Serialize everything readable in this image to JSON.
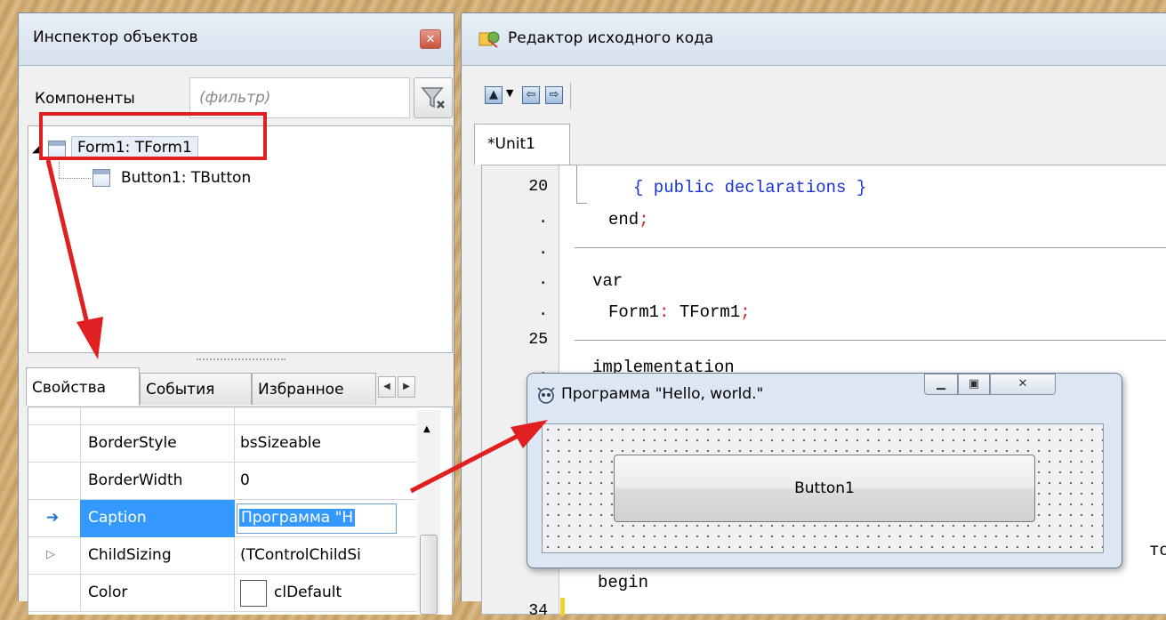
{
  "inspector": {
    "title": "Инспектор объектов",
    "close_icon": "close-icon",
    "filter_label": "Компоненты",
    "filter_placeholder": "(фильтр)",
    "tree": [
      {
        "label": "Form1: TForm1"
      },
      {
        "label": "Button1: TButton"
      }
    ],
    "tabs": [
      "Свойства",
      "События",
      "Избранное"
    ],
    "properties": [
      {
        "name": "BorderStyle",
        "value": "bsSizeable"
      },
      {
        "name": "BorderWidth",
        "value": "0"
      },
      {
        "name": "Caption",
        "value": "Программа \"Н"
      },
      {
        "name": "ChildSizing",
        "value": "(TControlChildSi"
      },
      {
        "name": "Color",
        "value": "clDefault"
      }
    ]
  },
  "editor": {
    "title": "Редактор исходного кода",
    "tab": "*Unit1",
    "line_numbers": [
      "20",
      ".",
      ".",
      ".",
      ".",
      "25",
      ".",
      "34"
    ],
    "code": {
      "public_decl": "{ public declarations }",
      "end": "end",
      "semicolon": ";",
      "var": "var",
      "form1": "Form1",
      "colon": ":",
      "tform1": " TForm1",
      "implementation": "implementation",
      "begin_fragment": "begin",
      "tok_fragment": "тон"
    }
  },
  "form": {
    "caption": "Программа \"Hello,  world.\"",
    "button_label": "Button1"
  },
  "colors": {
    "selection": "#3399ff",
    "annotation": "#e02020",
    "comment": "#1a33d6"
  }
}
